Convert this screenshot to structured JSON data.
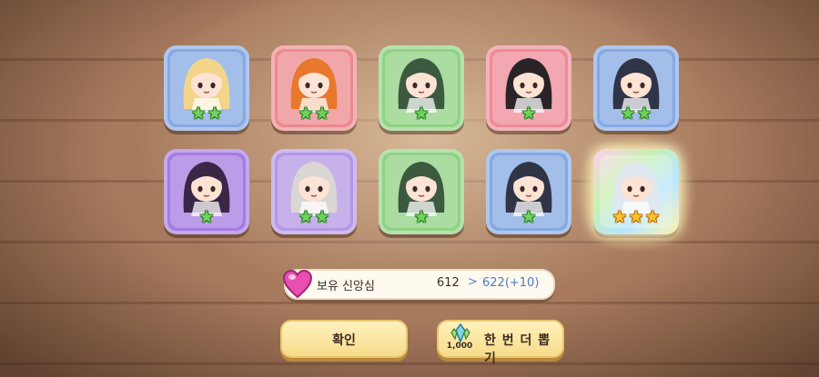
{
  "colors": {
    "blue": "#86a9e3",
    "red": "#ec8a8d",
    "green": "#8fd283",
    "pink": "#ef8a98",
    "purple": "#a57be2",
    "lilac": "#b597e4",
    "rainbow": "#d9f2b6",
    "star_green": "#6fd35a",
    "star_gold": "#ffc52a"
  },
  "results": [
    {
      "card_color": "blue",
      "stars": 2,
      "star_type": "green",
      "icon": "blonde-girl-portrait-icon"
    },
    {
      "card_color": "red",
      "stars": 2,
      "star_type": "green",
      "icon": "fire-spirit-portrait-icon"
    },
    {
      "card_color": "green",
      "stars": 1,
      "star_type": "green",
      "icon": "green-hair-girl-portrait-icon"
    },
    {
      "card_color": "pink",
      "stars": 1,
      "star_type": "green",
      "icon": "black-hair-girl-portrait-icon"
    },
    {
      "card_color": "blue",
      "stars": 2,
      "star_type": "green",
      "icon": "dark-hair-girl-portrait-icon"
    },
    {
      "card_color": "purple",
      "stars": 1,
      "star_type": "green",
      "icon": "purple-hair-girl-portrait-icon"
    },
    {
      "card_color": "lilac",
      "stars": 2,
      "star_type": "green",
      "icon": "silver-hair-girl-portrait-icon"
    },
    {
      "card_color": "green",
      "stars": 1,
      "star_type": "green",
      "icon": "green-hair-girl-portrait-icon"
    },
    {
      "card_color": "blue",
      "stars": 1,
      "star_type": "green",
      "icon": "dark-hair-girl-portrait-icon"
    },
    {
      "card_color": "rainbow",
      "stars": 3,
      "star_type": "gold",
      "icon": "white-hair-girl-portrait-icon"
    }
  ],
  "faith": {
    "label": "보유 신앙심",
    "current": "612",
    "arrow": ">",
    "new": "622(+10)",
    "icon": "heart-icon"
  },
  "buttons": {
    "confirm": "확인",
    "draw_once": "한 번 더 뽑기",
    "draw_cost": "1,000",
    "draw_icon": "crystal-icon"
  }
}
